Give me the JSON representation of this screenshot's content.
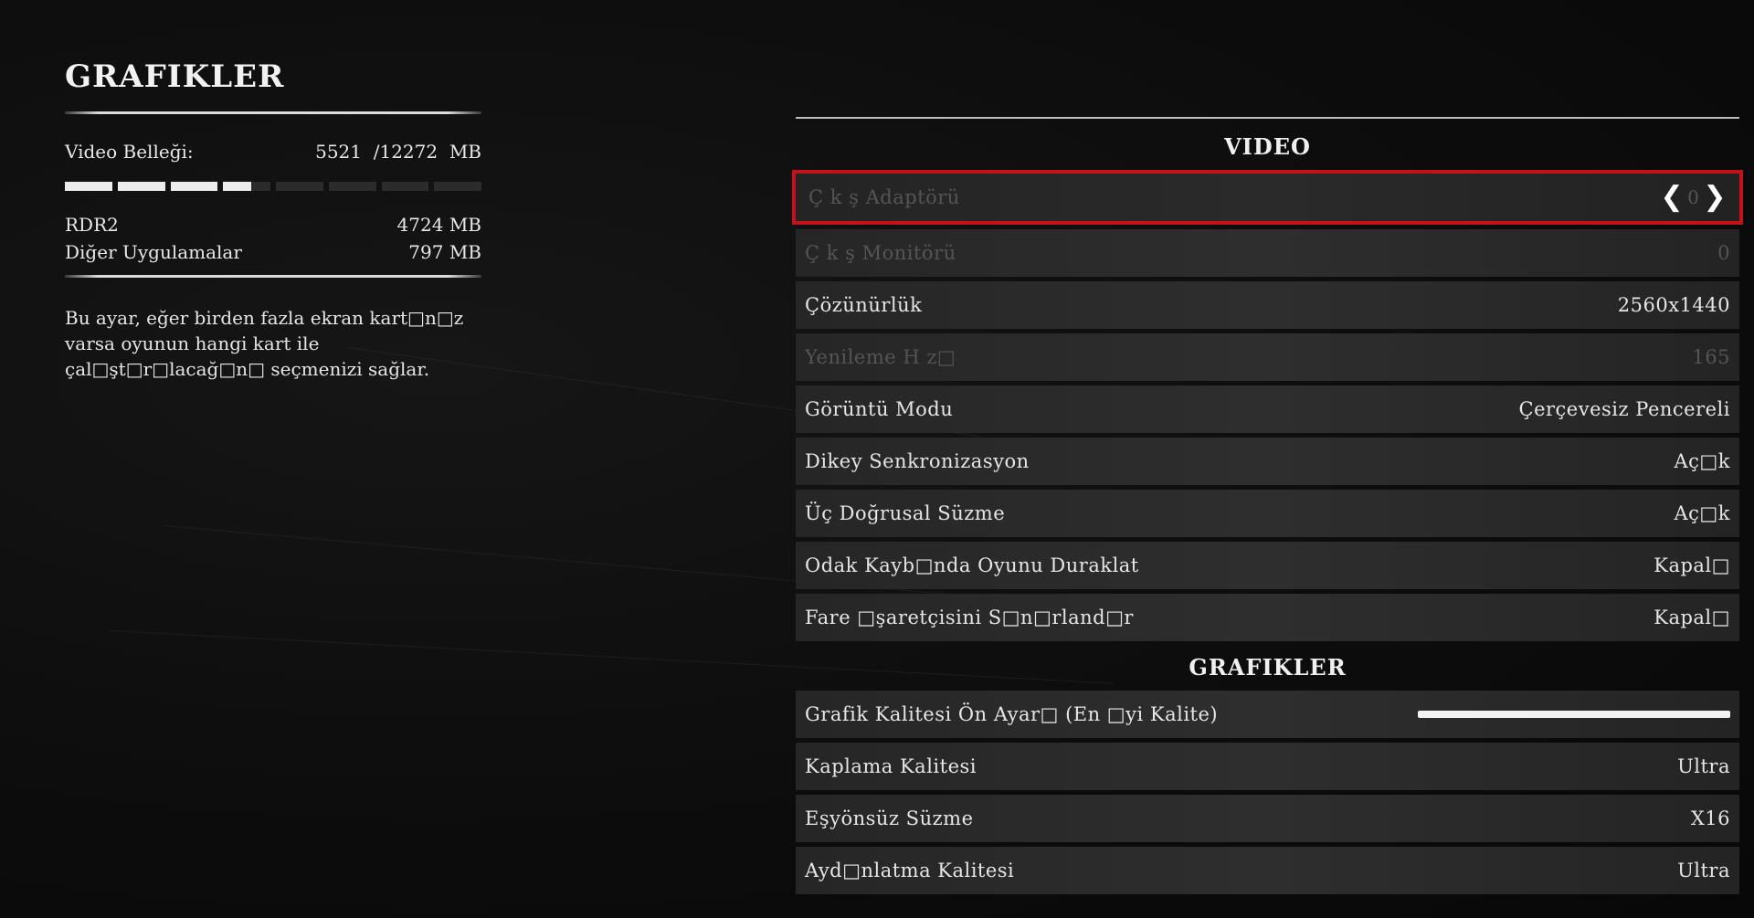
{
  "left": {
    "title": "Grafikler",
    "memory": {
      "label": "Video Belleği:",
      "used": "5521",
      "separator": "/",
      "total": "12272",
      "unit": "MB",
      "usage_fraction": 0.45
    },
    "breakdown": [
      {
        "label": "RDR2",
        "value": "4724",
        "unit": "MB"
      },
      {
        "label": "Diğer Uygulamalar",
        "value": "797",
        "unit": "MB"
      }
    ],
    "description": "Bu ayar, eğer birden fazla ekran kart□n□z varsa oyunun hangi kart ile çal□şt□r□lacağ□n□ seçmenizi sağlar."
  },
  "right": {
    "video_section_title": "Video",
    "graphics_section_title": "Grafikler",
    "video_rows": [
      {
        "label": "Ç k ş Adaptörü",
        "value": "0",
        "state": "selected-disabled"
      },
      {
        "label": "Ç k ş Monitörü",
        "value": "0",
        "state": "disabled"
      },
      {
        "label": "Çözünürlük",
        "value": "2560x1440",
        "state": "normal"
      },
      {
        "label": "Yenileme H z□",
        "value": "165",
        "state": "disabled"
      },
      {
        "label": "Görüntü Modu",
        "value": "Çerçevesiz Pencereli",
        "state": "normal"
      },
      {
        "label": "Dikey Senkronizasyon",
        "value": "Aç□k",
        "state": "normal"
      },
      {
        "label": "Üç Doğrusal Süzme",
        "value": "Aç□k",
        "state": "normal"
      },
      {
        "label": "Odak Kayb□nda Oyunu Duraklat",
        "value": "Kapal□",
        "state": "normal"
      },
      {
        "label": "Fare □şaretçisini S□n□rland□r",
        "value": "Kapal□",
        "state": "normal"
      }
    ],
    "graphics_rows": [
      {
        "label": "Grafik Kalitesi Ön Ayar□ (En □yi Kalite)",
        "slider_fraction": 1.0
      },
      {
        "label": "Kaplama Kalitesi",
        "value": "Ultra"
      },
      {
        "label": "Eşyönsüz Süzme",
        "value": "X16"
      },
      {
        "label": "Ayd□nlatma Kalitesi",
        "value": "Ultra"
      }
    ],
    "selection_color": "#c4121b",
    "icons": {
      "prev": "chevron-left-icon",
      "next": "chevron-right-icon"
    }
  }
}
